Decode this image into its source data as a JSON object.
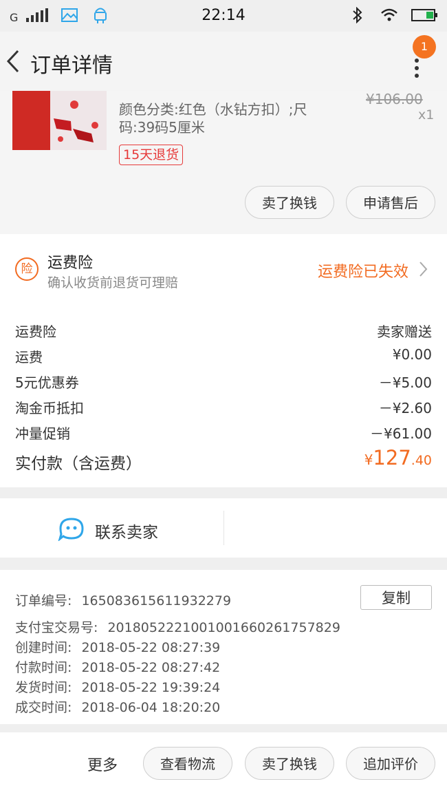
{
  "status_bar": {
    "carrier": "G",
    "time": "22:14"
  },
  "header": {
    "title": "订单详情",
    "notification_count": "1"
  },
  "product": {
    "attributes": "颜色分类:红色（水钻方扣）;尺码:39码5厘米",
    "original_price": "¥106.00",
    "quantity": "x1",
    "return_badge": "15天退货",
    "btn_sell": "卖了换钱",
    "btn_after_sales": "申请售后"
  },
  "insurance": {
    "icon_text": "险",
    "title": "运费险",
    "subtitle": "确认收货前退货可理赔",
    "status": "运费险已失效"
  },
  "fees": {
    "rows": [
      {
        "label": "运费险",
        "value": "卖家赠送"
      },
      {
        "label": "运费",
        "value": "¥0.00"
      },
      {
        "label": "5元优惠券",
        "value": "－¥5.00"
      },
      {
        "label": "淘金币抵扣",
        "value": "－¥2.60"
      },
      {
        "label": "冲量促销",
        "value": "－¥61.00"
      }
    ],
    "total_label": "实付款（含运费）",
    "total_symbol": "¥",
    "total_int": "127",
    "total_dec": ".40"
  },
  "contact": {
    "label": "联系卖家"
  },
  "order_info": {
    "order_no_label": "订单编号:",
    "order_no": "165083615611932279",
    "copy_label": "复制",
    "alipay_label": "支付宝交易号:",
    "alipay_no": "2018052221001001660261757829",
    "created_label": "创建时间:",
    "created": "2018-05-22 08:27:39",
    "paid_label": "付款时间:",
    "paid": "2018-05-22 08:27:42",
    "shipped_label": "发货时间:",
    "shipped": "2018-05-22 19:39:24",
    "completed_label": "成交时间:",
    "completed": "2018-06-04 18:20:20"
  },
  "bottom_bar": {
    "more": "更多",
    "logistics": "查看物流",
    "sell": "卖了换钱",
    "review": "追加评价"
  },
  "colors": {
    "accent": "#f26b21",
    "badge_red": "#e63a3a",
    "contact_blue": "#2fa6e9"
  }
}
